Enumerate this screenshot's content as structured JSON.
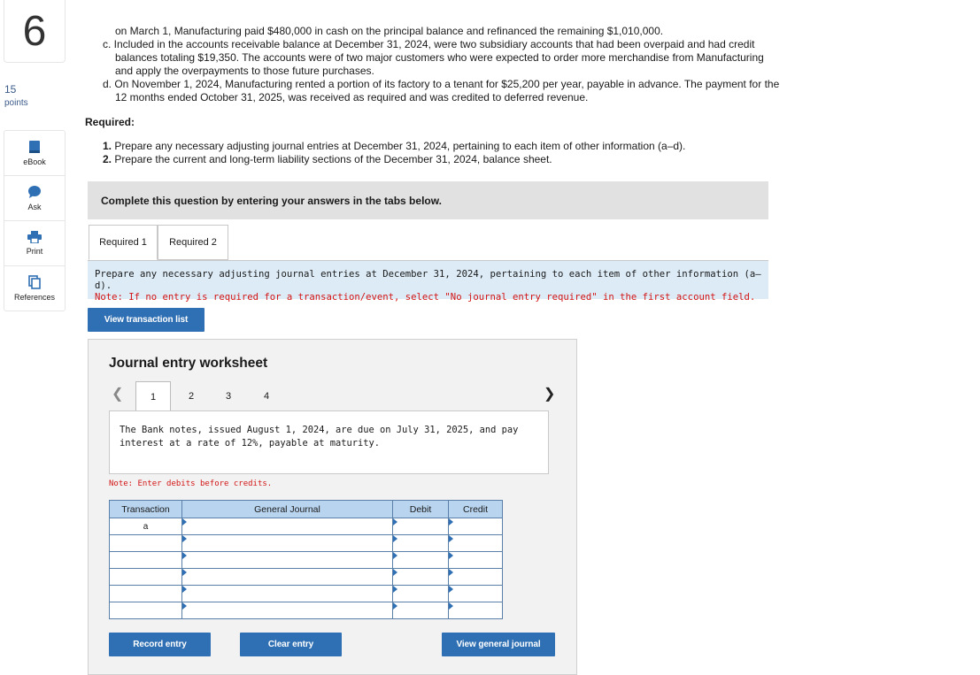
{
  "question": {
    "number": "6",
    "points_value": "15",
    "points_label": "points"
  },
  "rail": [
    {
      "label": "eBook",
      "icon": "book-icon"
    },
    {
      "label": "Ask",
      "icon": "chat-icon"
    },
    {
      "label": "Print",
      "icon": "printer-icon"
    },
    {
      "label": "References",
      "icon": "copy-icon"
    }
  ],
  "problem": {
    "line0": "on March 1, Manufacturing paid $480,000 in cash on the principal balance and refinanced the remaining $1,010,000.",
    "item_c": "c. Included in the accounts receivable balance at December 31, 2024, were two subsidiary accounts that had been overpaid and had credit balances totaling $19,350. The accounts were of two major customers who were expected to order more merchandise from Manufacturing and apply the overpayments to those future purchases.",
    "item_d": "d. On November 1, 2024, Manufacturing rented a portion of its factory to a tenant for $25,200 per year, payable in advance. The payment for the 12 months ended October 31, 2025, was received as required and was credited to deferred revenue."
  },
  "required": {
    "title": "Required:",
    "r1_num": "1.",
    "r1_text": " Prepare any necessary adjusting journal entries at December 31, 2024, pertaining to each item of other information (a–d).",
    "r2_num": "2.",
    "r2_text": " Prepare the current and long-term liability sections of the December 31, 2024, balance sheet."
  },
  "banner": "Complete this question by entering your answers in the tabs below.",
  "tabs": [
    "Required 1",
    "Required 2"
  ],
  "instruction": {
    "text": "Prepare any necessary adjusting journal entries at December 31, 2024, pertaining to each item of other information (a–d).",
    "note": "Note: If no entry is required for a transaction/event, select \"No journal entry required\" in the first account field."
  },
  "view_transaction_list": "View transaction list",
  "worksheet": {
    "title": "Journal entry worksheet",
    "pages": [
      "1",
      "2",
      "3",
      "4"
    ],
    "active_page": "1",
    "prev_icon": "chevron-left-icon",
    "next_icon": "chevron-right-icon",
    "description": "The Bank notes, issued August 1, 2024, are due on July 31, 2025, and pay interest at a rate of 12%, payable at maturity.",
    "note": "Note: Enter debits before credits.",
    "columns": [
      "Transaction",
      "General Journal",
      "Debit",
      "Credit"
    ],
    "rows": [
      "a",
      "",
      "",
      "",
      "",
      ""
    ],
    "record_entry": "Record entry",
    "clear_entry": "Clear entry",
    "view_general_journal": "View general journal"
  },
  "colors": {
    "button": "#2f6fb3",
    "header_fill": "#b8d4ef",
    "note_red": "#d31515",
    "instr_bg": "#dcebf6"
  }
}
